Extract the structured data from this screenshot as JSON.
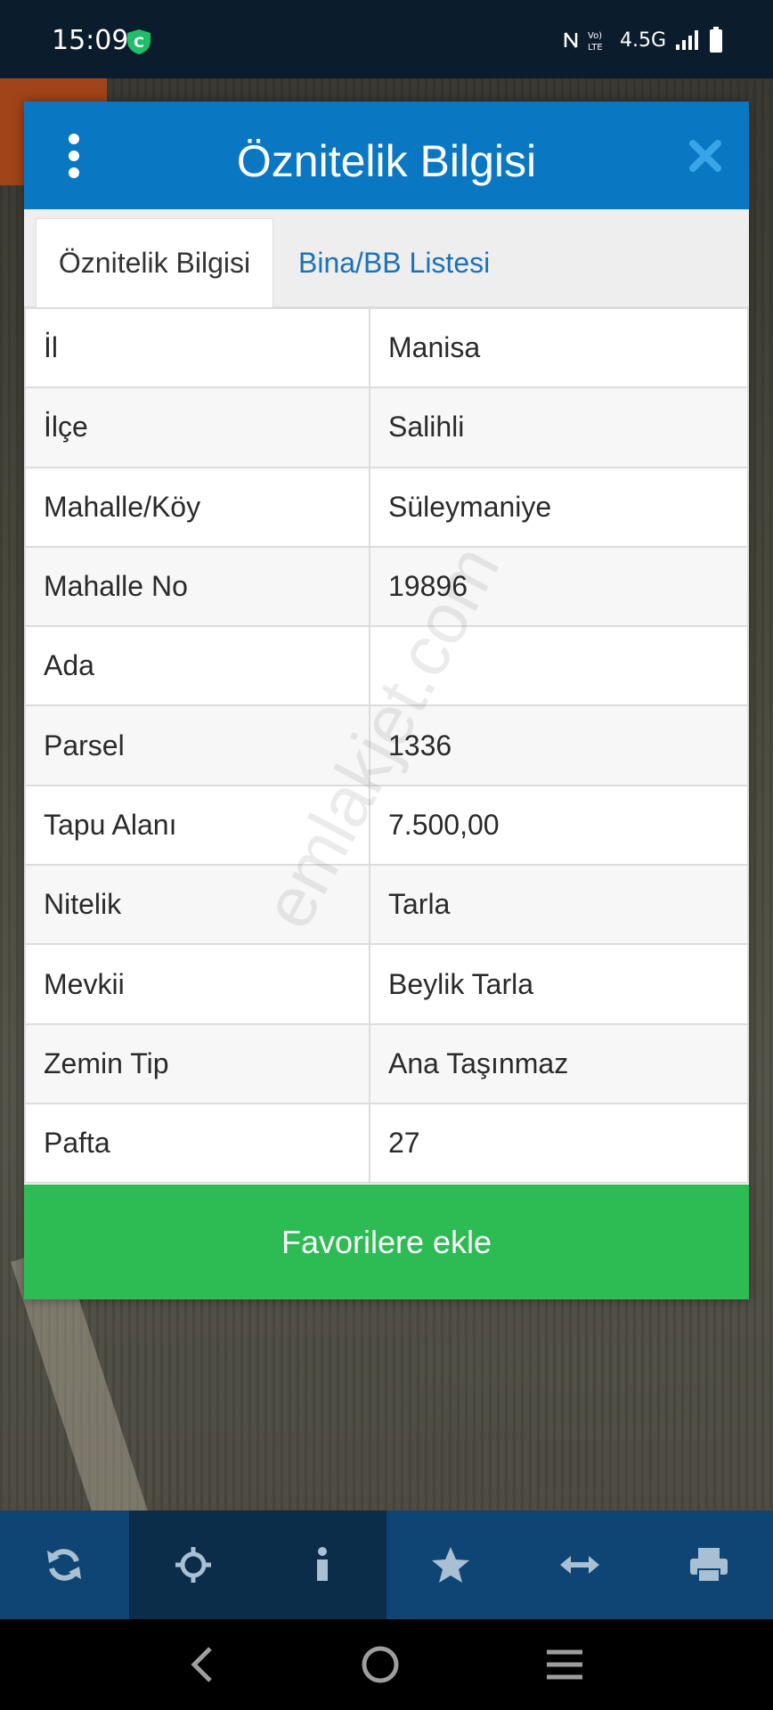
{
  "status_bar": {
    "time": "15:09",
    "network": "4.5G",
    "icons": [
      "shield-icon",
      "nfc-icon",
      "volte-icon",
      "signal-icon",
      "battery-icon"
    ]
  },
  "dialog": {
    "title": "Öznitelik Bilgisi",
    "tabs": [
      {
        "label": "Öznitelik Bilgisi",
        "active": true
      },
      {
        "label": "Bina/BB Listesi",
        "active": false
      }
    ],
    "rows": [
      {
        "key": "İl",
        "value": "Manisa"
      },
      {
        "key": "İlçe",
        "value": "Salihli"
      },
      {
        "key": "Mahalle/Köy",
        "value": "Süleymaniye"
      },
      {
        "key": "Mahalle No",
        "value": "19896"
      },
      {
        "key": "Ada",
        "value": ""
      },
      {
        "key": "Parsel",
        "value": "1336"
      },
      {
        "key": "Tapu Alanı",
        "value": "7.500,00"
      },
      {
        "key": "Nitelik",
        "value": "Tarla"
      },
      {
        "key": "Mevkii",
        "value": "Beylik Tarla"
      },
      {
        "key": "Zemin Tip",
        "value": "Ana Taşınmaz"
      },
      {
        "key": "Pafta",
        "value": "27"
      }
    ],
    "favorite_label": "Favorilere ekle"
  },
  "watermark": "emlakjet.com",
  "toolbar": {
    "items": [
      "refresh-icon",
      "locate-icon",
      "info-icon",
      "star-icon",
      "measure-icon",
      "print-icon"
    ]
  },
  "colors": {
    "header": "#0a77c2",
    "favorite": "#2dbb54",
    "toolbar": "#0f4574"
  }
}
